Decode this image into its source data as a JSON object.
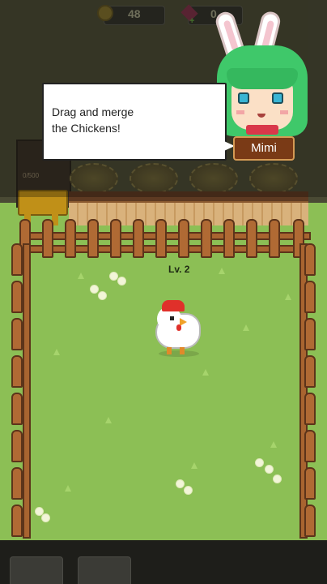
{
  "header": {
    "coins": "48",
    "gems": "0",
    "coin_icon": "coin-icon",
    "gem_icon": "gem-icon"
  },
  "tutorial": {
    "message": "Drag and merge\nthe Chickens!",
    "speaker_name": "Mimi"
  },
  "coop": {
    "capacity_text": "0/500"
  },
  "chicken": {
    "level_label": "Lv. 2"
  },
  "colors": {
    "grass": "#8cbf55",
    "fence": "#b06a34",
    "bubble": "#ffffff",
    "name_tag": "#7a3a16"
  }
}
